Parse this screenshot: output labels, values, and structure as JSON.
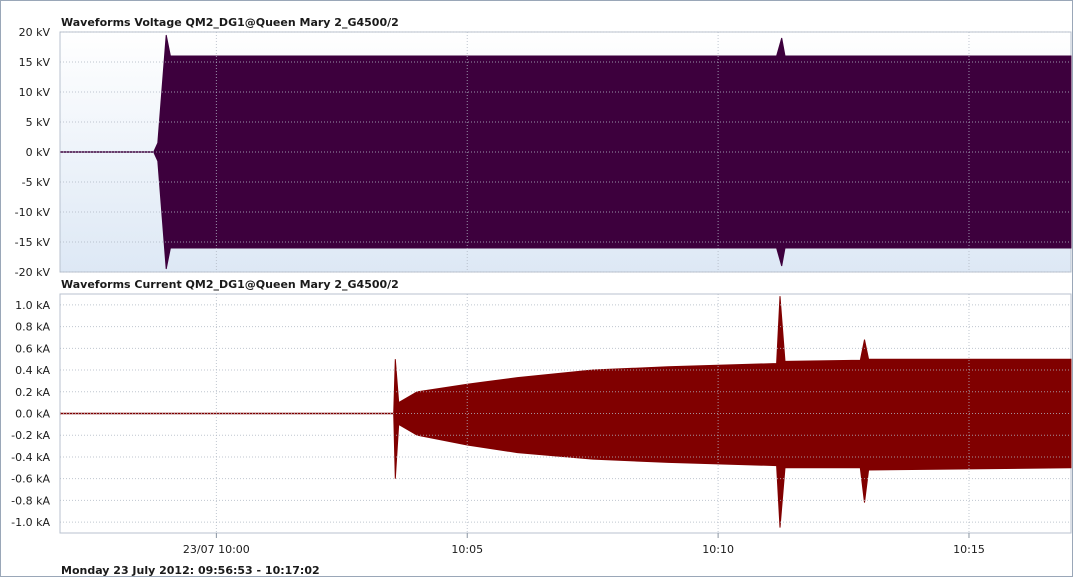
{
  "footer": {
    "date_range": "Monday 23 July 2012: 09:56:53 - 10:17:02"
  },
  "time_axis": {
    "start": "2012-07-23 09:56:53",
    "end": "2012-07-23 10:17:02",
    "ticks": [
      {
        "time": "2012-07-23 10:00:00",
        "label": "23/07 10:00"
      },
      {
        "time": "2012-07-23 10:05:00",
        "label": "10:05"
      },
      {
        "time": "2012-07-23 10:10:00",
        "label": "10:10"
      },
      {
        "time": "2012-07-23 10:15:00",
        "label": "10:15"
      }
    ]
  },
  "chart_data": [
    {
      "type": "area",
      "title": "Waveforms Voltage QM2_DG1@Queen Mary 2_G4500/2",
      "y_unit": "kV",
      "ylim": [
        -20,
        20
      ],
      "yticks": [
        {
          "value": 20,
          "label": "20 kV"
        },
        {
          "value": 15,
          "label": "15 kV"
        },
        {
          "value": 10,
          "label": "10 kV"
        },
        {
          "value": 5,
          "label": "5 kV"
        },
        {
          "value": 0,
          "label": "0 kV"
        },
        {
          "value": -5,
          "label": "-5 kV"
        },
        {
          "value": -10,
          "label": "-10 kV"
        },
        {
          "value": -15,
          "label": "-15 kV"
        },
        {
          "value": -20,
          "label": "-20 kV"
        }
      ],
      "grid": true,
      "background_gradient": [
        "#ffffff",
        "#dde8f5"
      ],
      "series": [
        {
          "color": "#3d003d",
          "envelope": [
            {
              "time": "2012-07-23 09:56:53",
              "max": 0,
              "min": 0
            },
            {
              "time": "2012-07-23 09:58:45",
              "max": 0,
              "min": 0
            },
            {
              "time": "2012-07-23 09:58:50",
              "max": 1.5,
              "min": -1.5
            },
            {
              "time": "2012-07-23 09:59:00",
              "max": 19.5,
              "min": -19.5
            },
            {
              "time": "2012-07-23 09:59:05",
              "max": 16,
              "min": -16
            },
            {
              "time": "2012-07-23 10:11:10",
              "max": 16,
              "min": -16
            },
            {
              "time": "2012-07-23 10:11:16",
              "max": 19,
              "min": -19
            },
            {
              "time": "2012-07-23 10:11:20",
              "max": 16,
              "min": -16
            },
            {
              "time": "2012-07-23 10:17:02",
              "max": 16,
              "min": -16
            }
          ]
        }
      ]
    },
    {
      "type": "area",
      "title": "Waveforms Current QM2_DG1@Queen Mary 2_G4500/2",
      "y_unit": "kA",
      "ylim": [
        -1.1,
        1.1
      ],
      "yticks": [
        {
          "value": 1.0,
          "label": "1.0 kA"
        },
        {
          "value": 0.8,
          "label": "0.8 kA"
        },
        {
          "value": 0.6,
          "label": "0.6 kA"
        },
        {
          "value": 0.4,
          "label": "0.4 kA"
        },
        {
          "value": 0.2,
          "label": "0.2 kA"
        },
        {
          "value": 0.0,
          "label": "0.0 kA"
        },
        {
          "value": -0.2,
          "label": "-0.2 kA"
        },
        {
          "value": -0.4,
          "label": "-0.4 kA"
        },
        {
          "value": -0.6,
          "label": "-0.6 kA"
        },
        {
          "value": -0.8,
          "label": "-0.8 kA"
        },
        {
          "value": -1.0,
          "label": "-1.0 kA"
        }
      ],
      "grid": true,
      "series": [
        {
          "color": "#1a7a1a"
        },
        {
          "color": "#1a237e"
        },
        {
          "color": "#800000",
          "envelope": [
            {
              "time": "2012-07-23 09:56:53",
              "max": 0,
              "min": 0
            },
            {
              "time": "2012-07-23 10:03:32",
              "max": 0,
              "min": 0
            },
            {
              "time": "2012-07-23 10:03:34",
              "max": 0.5,
              "min": -0.6
            },
            {
              "time": "2012-07-23 10:03:38",
              "max": 0.1,
              "min": -0.1
            },
            {
              "time": "2012-07-23 10:04:00",
              "max": 0.2,
              "min": -0.2
            },
            {
              "time": "2012-07-23 10:05:00",
              "max": 0.27,
              "min": -0.29
            },
            {
              "time": "2012-07-23 10:06:00",
              "max": 0.33,
              "min": -0.36
            },
            {
              "time": "2012-07-23 10:07:30",
              "max": 0.4,
              "min": -0.42
            },
            {
              "time": "2012-07-23 10:09:00",
              "max": 0.43,
              "min": -0.45
            },
            {
              "time": "2012-07-23 10:11:10",
              "max": 0.46,
              "min": -0.48
            },
            {
              "time": "2012-07-23 10:11:14",
              "max": 1.08,
              "min": -1.05
            },
            {
              "time": "2012-07-23 10:11:20",
              "max": 0.48,
              "min": -0.5
            },
            {
              "time": "2012-07-23 10:12:50",
              "max": 0.49,
              "min": -0.5
            },
            {
              "time": "2012-07-23 10:12:55",
              "max": 0.68,
              "min": -0.82
            },
            {
              "time": "2012-07-23 10:13:00",
              "max": 0.5,
              "min": -0.52
            },
            {
              "time": "2012-07-23 10:17:02",
              "max": 0.5,
              "min": -0.5
            }
          ]
        }
      ]
    }
  ]
}
